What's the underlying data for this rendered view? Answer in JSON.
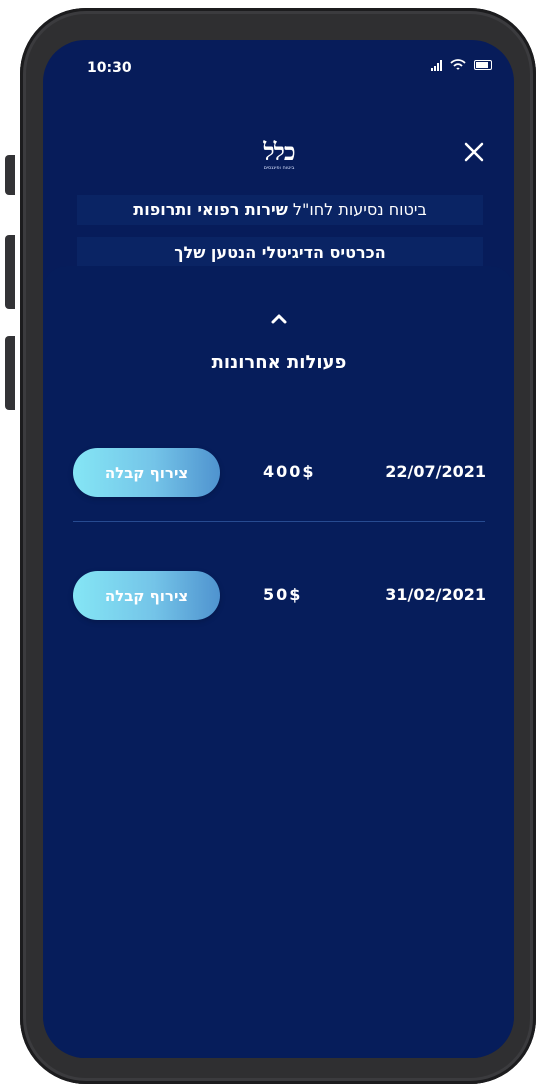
{
  "status_bar": {
    "time": "10:30",
    "signal_icon": "signal-icon",
    "wifi_icon": "wifi-icon",
    "battery_icon": "battery-icon"
  },
  "header": {
    "logo_text": "כלל",
    "logo_subtitle": "ביטוח ופיננסים",
    "close_icon": "close-icon"
  },
  "policy": {
    "prefix": "ביטוח נסיעות לחו\"ל ",
    "highlight": "שירות רפואי ותרופות"
  },
  "card": {
    "title": "הכרטיס הדיגיטלי הנטען שלך"
  },
  "recent": {
    "title": "פעולות אחרונות",
    "toggle_icon": "chevron-up-icon"
  },
  "transactions": [
    {
      "date": "22/07/2021",
      "amount": "400$",
      "button": "צירוף קבלה"
    },
    {
      "date": "31/02/2021",
      "amount": "50$",
      "button": "צירוף קבלה"
    }
  ],
  "colors": {
    "background": "#071c5a",
    "button_start": "#85e6f5",
    "button_end": "#4f93cf"
  }
}
